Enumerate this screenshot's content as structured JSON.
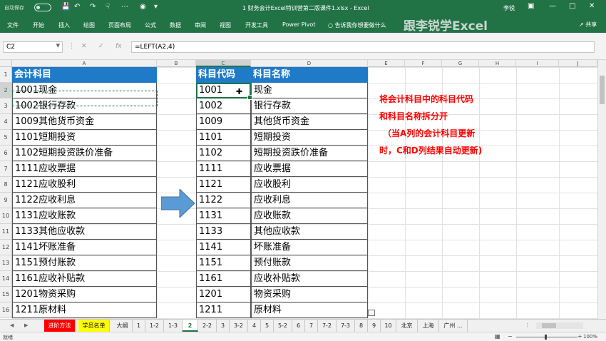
{
  "titlebar": {
    "autosave": "自动保存",
    "autosave_state": "关",
    "title": "1 财务会计Excel特训营第二版课件1.xlsx  -  Excel",
    "user": "李锐",
    "qat_icons": [
      "save-icon",
      "undo-icon",
      "redo-icon",
      "touch-icon",
      "camera-icon",
      "customize-icon"
    ]
  },
  "ribbon": {
    "tabs": [
      "文件",
      "开始",
      "插入",
      "绘图",
      "页面布局",
      "公式",
      "数据",
      "审阅",
      "视图",
      "开发工具",
      "Power Pivot"
    ],
    "tell_me": "告诉我你想要做什么",
    "brand": "跟李锐学Excel",
    "share": "共享"
  },
  "formula_bar": {
    "name_box": "C2",
    "formula": "=LEFT(A2,4)"
  },
  "columns": [
    "A",
    "B",
    "C",
    "D",
    "E",
    "F",
    "G",
    "H",
    "I",
    "J"
  ],
  "rows": [
    "1",
    "2",
    "3",
    "4",
    "5",
    "6",
    "7",
    "8",
    "9",
    "10",
    "11",
    "12",
    "13",
    "14",
    "15",
    "16"
  ],
  "sheet": {
    "header_a": "会计科目",
    "header_c": "科目代码",
    "header_d": "科目名称",
    "col_a": [
      "1001现金",
      "1002银行存款",
      "1009其他货币资金",
      "1101短期投资",
      "1102短期投资跌价准备",
      "1111应收票据",
      "1121应收股利",
      "1122应收利息",
      "1131应收账款",
      "1133其他应收款",
      "1141坏账准备",
      "1151预付账款",
      "1161应收补贴款",
      "1201物资采购",
      "1211原材料"
    ],
    "col_c": [
      "1001",
      "1002",
      "1009",
      "1101",
      "1102",
      "1111",
      "1121",
      "1122",
      "1131",
      "1133",
      "1141",
      "1151",
      "1161",
      "1201",
      "1211"
    ],
    "col_d": [
      "现金",
      "银行存款",
      "其他货币资金",
      "短期投资",
      "短期投资跌价准备",
      "应收票据",
      "应收股利",
      "应收利息",
      "应收账款",
      "其他应收款",
      "坏账准备",
      "预付账款",
      "应收补贴款",
      "物资采购",
      "原材料"
    ]
  },
  "note_lines": [
    "将会计科目中的科目代码",
    "和科目名称拆分开",
    "（当A列的会计科目更新",
    "时，C和D列结果自动更新)"
  ],
  "sheet_tabs": [
    "进阶方法",
    "学员名单",
    "大纲",
    "1",
    "1-2",
    "1-3",
    "2",
    "2-2",
    "3",
    "3-2",
    "4",
    "5",
    "5-2",
    "6",
    "7",
    "7-2",
    "7-3",
    "8",
    "9",
    "10",
    "北京",
    "上海",
    "广州 ..."
  ],
  "active_tab": "2",
  "status": {
    "ready": "就绪",
    "zoom": "100%"
  },
  "colors": {
    "excel_green": "#217346",
    "header_blue": "#1f7ac7",
    "note_red": "#ff0000",
    "arrow_blue": "#5b9bd5"
  }
}
